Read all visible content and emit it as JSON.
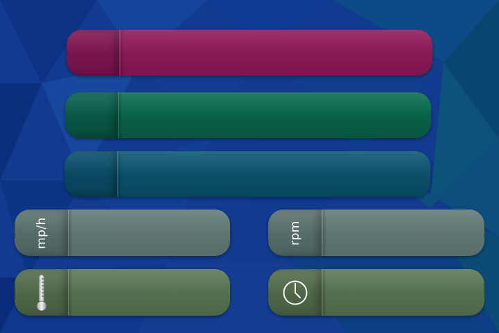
{
  "background": {
    "colors": [
      "#0e2a8a",
      "#123e9a",
      "#0b5a82",
      "#0a2e6e",
      "#0c4a7a",
      "#14357f"
    ]
  },
  "bars": [
    {
      "name": "magenta-bar",
      "color": "#8a1a56",
      "cap_color": "#7a1550"
    },
    {
      "name": "green-bar",
      "color": "#0b6a52",
      "cap_color": "#095a46"
    },
    {
      "name": "teal-bar",
      "color": "#0b5570",
      "cap_color": "#094a62"
    }
  ],
  "gauges": {
    "speed": {
      "unit": "mp/h",
      "color": "#5d7470"
    },
    "rpm": {
      "unit": "rpm",
      "color": "#5d7470"
    },
    "temperature": {
      "icon": "thermometer-icon",
      "color": "#55714e"
    },
    "time": {
      "icon": "clock-icon",
      "color": "#55714e"
    }
  }
}
